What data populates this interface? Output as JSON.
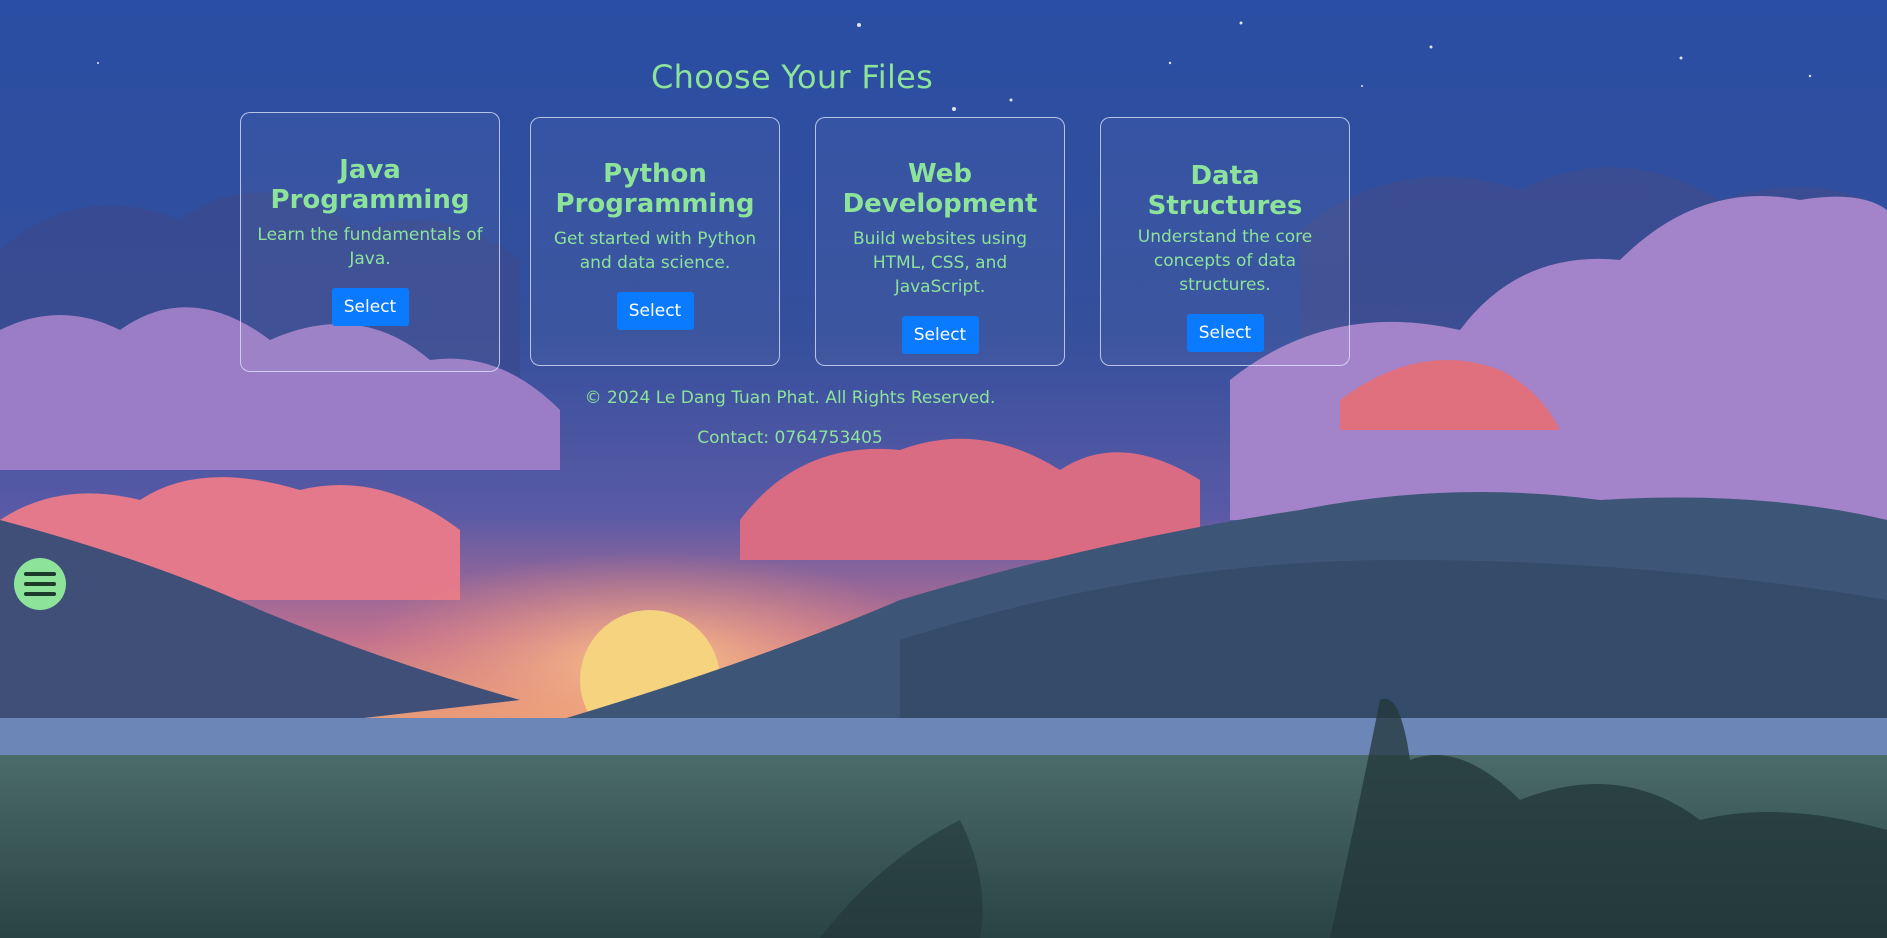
{
  "page": {
    "title": "Choose Your Files"
  },
  "cards": [
    {
      "title_line1": "Java",
      "title_line2": "Programming",
      "description": "Learn the fundamentals of Java.",
      "button_label": "Select"
    },
    {
      "title_line1": "Python",
      "title_line2": "Programming",
      "description": "Get started with Python and data science.",
      "button_label": "Select"
    },
    {
      "title_line1": "Web",
      "title_line2": "Development",
      "description": "Build websites using HTML, CSS, and JavaScript.",
      "button_label": "Select"
    },
    {
      "title_line1": "Data Structures",
      "title_line2": "",
      "description": "Understand the core concepts of data structures.",
      "button_label": "Select"
    }
  ],
  "footer": {
    "copyright": "© 2024 Le Dang Tuan Phat. All Rights Reserved.",
    "contact": "Contact: 0764753405"
  },
  "menu": {
    "icon": "hamburger-menu-icon"
  },
  "colors": {
    "accent_text": "#8de39a",
    "button_blue": "#0a7bff",
    "menu_button": "#8de39a"
  }
}
